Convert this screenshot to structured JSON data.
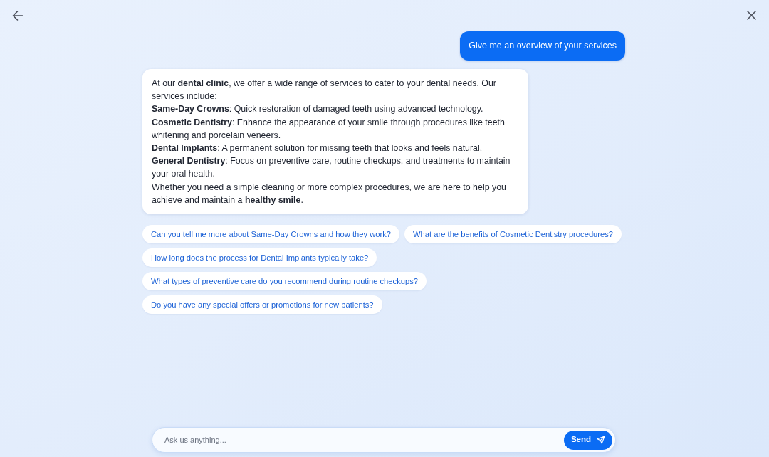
{
  "messages": [
    {
      "kind": "user",
      "text": "Give me an overview of your services"
    },
    {
      "kind": "assistant",
      "lines": [
        "At our **dental clinic**, we offer a wide range of services to cater to your dental needs. Our services include:",
        "**Same-Day Crowns**: Quick restoration of damaged teeth using advanced technology.",
        "**Cosmetic Dentistry**: Enhance the appearance of your smile through procedures like teeth whitening and porcelain veneers.",
        "**Dental Implants**: A permanent solution for missing teeth that looks and feels natural.",
        "**General Dentistry**: Focus on preventive care, routine checkups, and treatments to maintain your oral health.",
        "Whether you need a simple cleaning or more complex procedures, we are here to help you achieve and maintain a **healthy smile**."
      ]
    }
  ],
  "suggestions": [
    "Can you tell me more about Same-Day Crowns and how they work?",
    "What are the benefits of Cosmetic Dentistry procedures?",
    "How long does the process for Dental Implants typically take?",
    "What types of preventive care do you recommend during routine checkups?",
    "Do you have any special offers or promotions for new patients?"
  ],
  "composer": {
    "placeholder": "Ask us anything...",
    "send_label": "Send"
  }
}
